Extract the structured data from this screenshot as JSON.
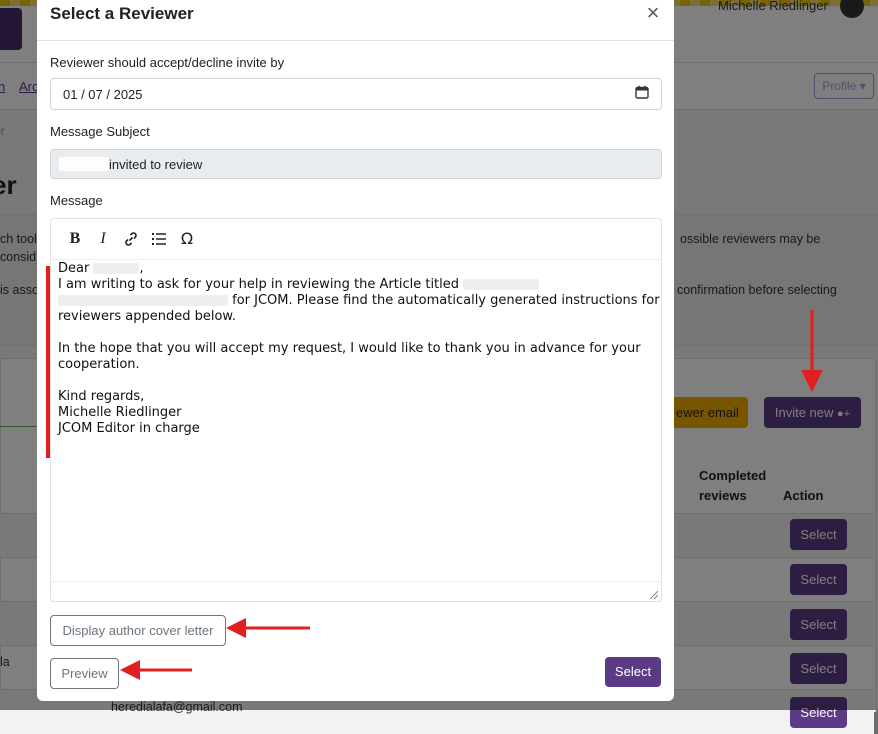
{
  "background": {
    "user_name": "Michelle Riedlinger",
    "nav_links": [
      "n",
      "Arc"
    ],
    "profile_label": "Profile ▾",
    "breadcrumb_tail": "er",
    "page_title_tail": "er",
    "info_lines": [
      "ch tool",
      "consid",
      "is asso"
    ],
    "info_right_1": "ossible reviewers may be",
    "info_right_2": "confirmation before selecting",
    "reviewer_email_button": "ewer email",
    "invite_new_button": "Invite new",
    "col_completed_1": "Completed",
    "col_completed_2": "reviews",
    "col_action": "Action",
    "row_select_label": "Select",
    "row_partial_text": "la",
    "row_email": "heredialafa@gmail.com"
  },
  "modal": {
    "title": "Select a Reviewer",
    "close_glyph": "×",
    "deadline_label": "Reviewer should accept/decline invite by",
    "deadline_value": "01 / 07 / 2025",
    "subject_label": "Message Subject",
    "subject_value": "invited to review",
    "message_label": "Message",
    "toolbar": {
      "bold": "B",
      "italic": "I",
      "omega": "Ω"
    },
    "message_lines": [
      "Dear",
      "I am writing to ask for your help in reviewing the Article titled",
      "for JCOM. Please find the automatically generated instructions for",
      "reviewers appended below.",
      "In the hope that you will accept my request, I would like to thank you in advance for your",
      "cooperation.",
      "Kind regards,",
      "Michelle Riedlinger",
      "JCOM Editor in charge"
    ],
    "cover_letter_button": "Display author cover letter",
    "preview_button": "Preview",
    "select_button": "Select"
  },
  "colors": {
    "primary": "#5b3b86",
    "warning": "#f0ad00",
    "annotation": "#e02020"
  }
}
